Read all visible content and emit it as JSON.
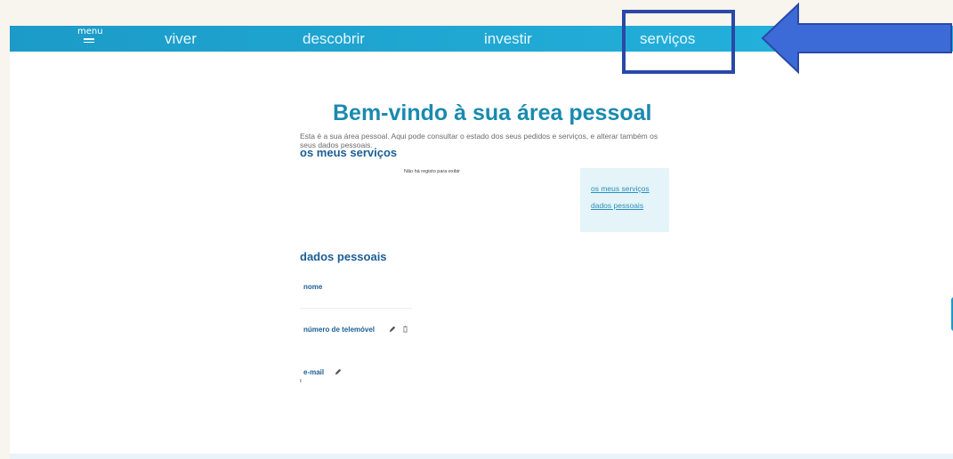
{
  "nav": {
    "menu_label": "menu",
    "items": [
      "viver",
      "descobrir",
      "investir",
      "serviços"
    ]
  },
  "page": {
    "title": "Bem-vindo à sua área pessoal",
    "intro": "Esta é a sua área pessoal. Aqui pode consultar o estado dos seus pedidos e serviços, e alterar também os seus dados pessoais."
  },
  "services": {
    "heading": "os meus serviços",
    "empty_text": "Não há registo para exibir"
  },
  "side_nav": {
    "links": [
      "os meus serviços",
      "dados pessoais"
    ]
  },
  "personal_data": {
    "heading": "dados pessoais",
    "fields": [
      "nome",
      "número de telemóvel",
      "e-mail"
    ]
  },
  "icons": {
    "edit": "pencil-icon",
    "delete": "trash-icon",
    "menu": "hamburger-icon",
    "annotation_arrow": "left-arrow"
  },
  "colors": {
    "nav_bar": "#1c9bc8",
    "title": "#1a8aaf",
    "heading": "#1b5e96",
    "annotation": "#2a48a8",
    "arrow_fill": "#3c6bd8"
  }
}
